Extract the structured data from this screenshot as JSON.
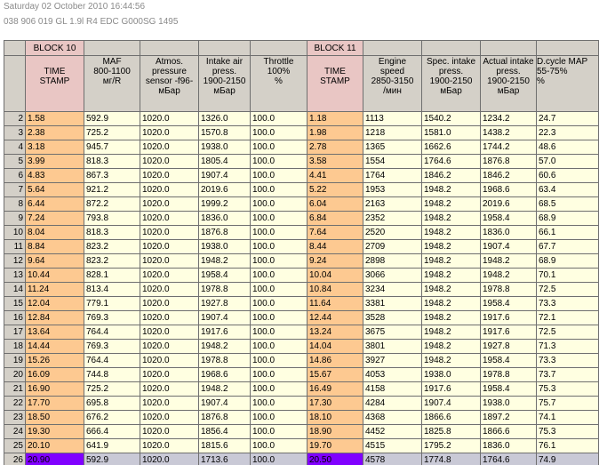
{
  "header": {
    "datetime": "Saturday 02 October 2010 16:44:56",
    "ecu": "038 906 019 GL  1.9l R4 EDC G000SG  1495"
  },
  "blocks": {
    "block10": "BLOCK 10",
    "block11": "BLOCK 11"
  },
  "columns": [
    "TIME\nSTAMP",
    "MAF\n800-1100\nмг/R",
    "Atmos.\npressure\nsensor -f96-\nмБар",
    "Intake air\npress.\n1900-2150\nмБар",
    "Throttle\n100%\n%",
    "TIME\nSTAMP",
    "Engine\nspeed\n2850-3150\n/мин",
    "Spec. intake\npress.\n1900-2150\nмБар",
    "Actual intake\npress.\n1900-2150\nмБар",
    "D.cycle MAP\n55-75%\n%"
  ],
  "rows": [
    [
      "2",
      "1.58",
      "592.9",
      "1020.0",
      "1326.0",
      "100.0",
      "1.18",
      "1113",
      "1540.2",
      "1234.2",
      "24.7"
    ],
    [
      "3",
      "2.38",
      "725.2",
      "1020.0",
      "1570.8",
      "100.0",
      "1.98",
      "1218",
      "1581.0",
      "1438.2",
      "22.3"
    ],
    [
      "4",
      "3.18",
      "945.7",
      "1020.0",
      "1938.0",
      "100.0",
      "2.78",
      "1365",
      "1662.6",
      "1744.2",
      "48.6"
    ],
    [
      "5",
      "3.99",
      "818.3",
      "1020.0",
      "1805.4",
      "100.0",
      "3.58",
      "1554",
      "1764.6",
      "1876.8",
      "57.0"
    ],
    [
      "6",
      "4.83",
      "867.3",
      "1020.0",
      "1907.4",
      "100.0",
      "4.41",
      "1764",
      "1846.2",
      "1846.2",
      "60.6"
    ],
    [
      "7",
      "5.64",
      "921.2",
      "1020.0",
      "2019.6",
      "100.0",
      "5.22",
      "1953",
      "1948.2",
      "1968.6",
      "63.4"
    ],
    [
      "8",
      "6.44",
      "872.2",
      "1020.0",
      "1999.2",
      "100.0",
      "6.04",
      "2163",
      "1948.2",
      "2019.6",
      "68.5"
    ],
    [
      "9",
      "7.24",
      "793.8",
      "1020.0",
      "1836.0",
      "100.0",
      "6.84",
      "2352",
      "1948.2",
      "1958.4",
      "68.9"
    ],
    [
      "10",
      "8.04",
      "818.3",
      "1020.0",
      "1876.8",
      "100.0",
      "7.64",
      "2520",
      "1948.2",
      "1836.0",
      "66.1"
    ],
    [
      "11",
      "8.84",
      "823.2",
      "1020.0",
      "1938.0",
      "100.0",
      "8.44",
      "2709",
      "1948.2",
      "1907.4",
      "67.7"
    ],
    [
      "12",
      "9.64",
      "823.2",
      "1020.0",
      "1948.2",
      "100.0",
      "9.24",
      "2898",
      "1948.2",
      "1948.2",
      "68.9"
    ],
    [
      "13",
      "10.44",
      "828.1",
      "1020.0",
      "1958.4",
      "100.0",
      "10.04",
      "3066",
      "1948.2",
      "1948.2",
      "70.1"
    ],
    [
      "14",
      "11.24",
      "813.4",
      "1020.0",
      "1978.8",
      "100.0",
      "10.84",
      "3234",
      "1948.2",
      "1978.8",
      "72.5"
    ],
    [
      "15",
      "12.04",
      "779.1",
      "1020.0",
      "1927.8",
      "100.0",
      "11.64",
      "3381",
      "1948.2",
      "1958.4",
      "73.3"
    ],
    [
      "16",
      "12.84",
      "769.3",
      "1020.0",
      "1907.4",
      "100.0",
      "12.44",
      "3528",
      "1948.2",
      "1917.6",
      "72.1"
    ],
    [
      "17",
      "13.64",
      "764.4",
      "1020.0",
      "1917.6",
      "100.0",
      "13.24",
      "3675",
      "1948.2",
      "1917.6",
      "72.5"
    ],
    [
      "18",
      "14.44",
      "769.3",
      "1020.0",
      "1948.2",
      "100.0",
      "14.04",
      "3801",
      "1948.2",
      "1927.8",
      "71.3"
    ],
    [
      "19",
      "15.26",
      "764.4",
      "1020.0",
      "1978.8",
      "100.0",
      "14.86",
      "3927",
      "1948.2",
      "1958.4",
      "73.3"
    ],
    [
      "20",
      "16.09",
      "744.8",
      "1020.0",
      "1968.6",
      "100.0",
      "15.67",
      "4053",
      "1938.0",
      "1978.8",
      "73.7"
    ],
    [
      "21",
      "16.90",
      "725.2",
      "1020.0",
      "1948.2",
      "100.0",
      "16.49",
      "4158",
      "1917.6",
      "1958.4",
      "75.3"
    ],
    [
      "22",
      "17.70",
      "695.8",
      "1020.0",
      "1907.4",
      "100.0",
      "17.30",
      "4284",
      "1907.4",
      "1938.0",
      "75.7"
    ],
    [
      "23",
      "18.50",
      "676.2",
      "1020.0",
      "1876.8",
      "100.0",
      "18.10",
      "4368",
      "1866.6",
      "1897.2",
      "74.1"
    ],
    [
      "24",
      "19.30",
      "666.4",
      "1020.0",
      "1856.4",
      "100.0",
      "18.90",
      "4452",
      "1825.8",
      "1866.6",
      "75.3"
    ],
    [
      "25",
      "20.10",
      "641.9",
      "1020.0",
      "1815.6",
      "100.0",
      "19.70",
      "4515",
      "1795.2",
      "1836.0",
      "76.1"
    ],
    [
      "26",
      "20.90",
      "592.9",
      "1020.0",
      "1713.6",
      "100.0",
      "20.50",
      "4578",
      "1774.8",
      "1764.6",
      "74.9"
    ]
  ],
  "selected_row": 24,
  "colors": {
    "cell_bg": "#ffffe1",
    "timestamp_bg": "#fdc991",
    "selected_timestamp_bg": "#8000ff",
    "header_bg": "#d4d0c8",
    "block_label_bg": "#e9c6c4"
  }
}
